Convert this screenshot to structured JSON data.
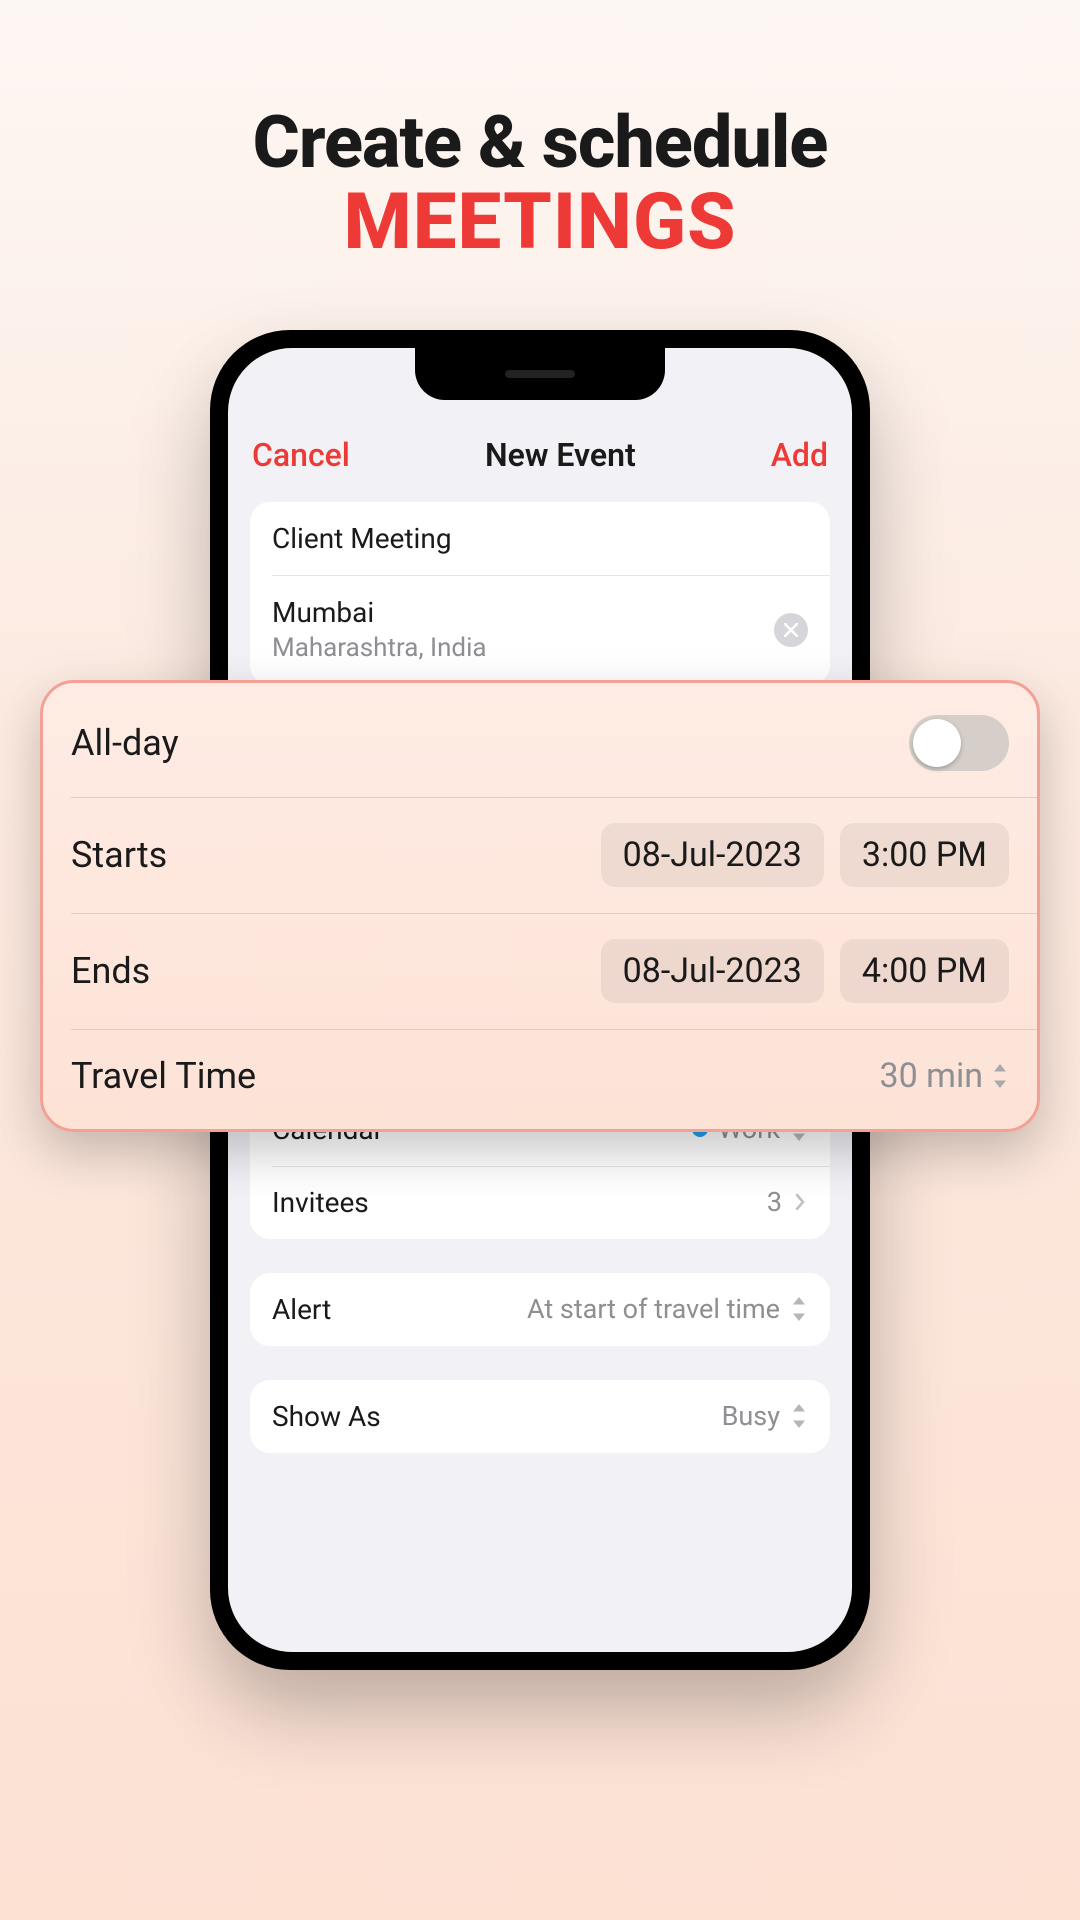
{
  "marketing": {
    "line1": "Create & schedule",
    "line2": "MEETINGS"
  },
  "nav": {
    "cancel": "Cancel",
    "title": "New Event",
    "add": "Add"
  },
  "event": {
    "title": "Client Meeting",
    "location_primary": "Mumbai",
    "location_secondary": "Maharashtra, India"
  },
  "time": {
    "all_day_label": "All-day",
    "starts_label": "Starts",
    "starts_date": "08-Jul-2023",
    "starts_time": "3:00 PM",
    "ends_label": "Ends",
    "ends_date": "08-Jul-2023",
    "ends_time": "4:00 PM",
    "travel_label": "Travel Time",
    "travel_value": "30 min"
  },
  "meta": {
    "calendar_label": "Calendar",
    "calendar_value": "Work",
    "invitees_label": "Invitees",
    "invitees_value": "3",
    "alert_label": "Alert",
    "alert_value": "At start of travel time",
    "showas_label": "Show As",
    "showas_value": "Busy"
  },
  "colors": {
    "accent": "#ee3a36",
    "calendar_dot": "#1e9ef0"
  }
}
